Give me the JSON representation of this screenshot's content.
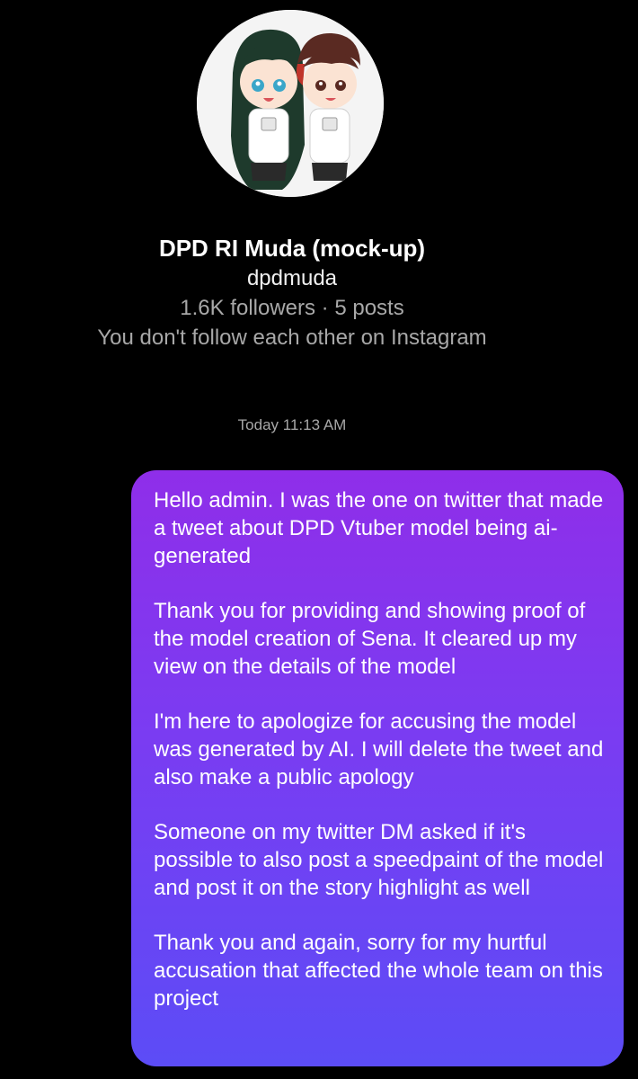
{
  "profile": {
    "name": "DPD RI Muda (mock-up)",
    "username": "dpdmuda",
    "stats": "1.6K followers · 5 posts",
    "follow_status": "You don't follow each other on Instagram",
    "avatar_icon": "chibi-duo-avatar-icon"
  },
  "thread": {
    "timestamp": "Today 11:13 AM",
    "message": {
      "paragraphs": [
        "Hello admin. I was the one on twitter that made a tweet about DPD Vtuber model being ai-generated",
        "Thank you for providing and showing proof of the model creation of Sena. It cleared up my view on the details of the model",
        "I'm here to apologize for accusing the model was generated by AI. I will delete the tweet and also make a public apology",
        "Someone on my twitter DM asked if it's possible to also post a speedpaint of the model and post it on the story highlight as well",
        "Thank you and again, sorry for my hurtful accusation that affected the whole team on this project"
      ]
    }
  },
  "colors": {
    "background": "#000000",
    "bubble_top": "#8f2ee9",
    "bubble_bottom": "#5c4cf6",
    "secondary_text": "#a8a8a8"
  }
}
